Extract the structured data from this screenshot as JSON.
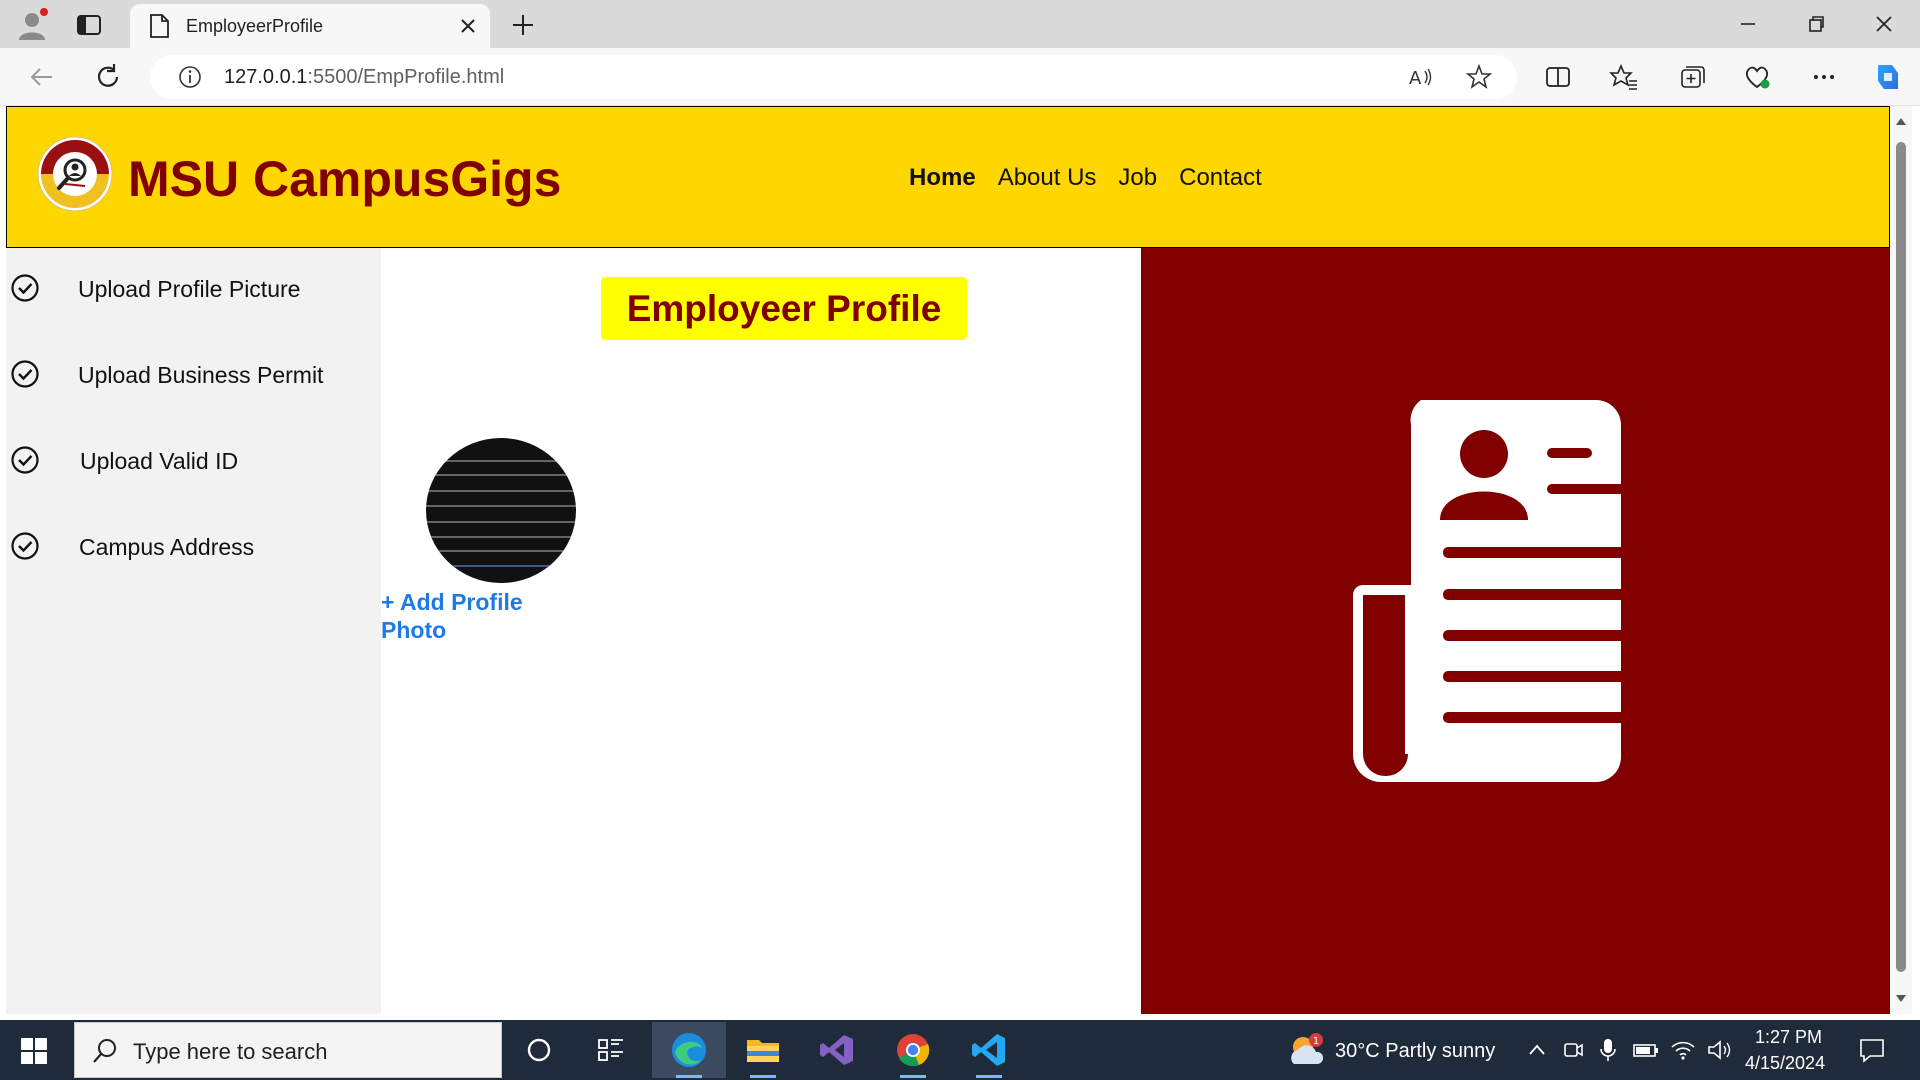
{
  "browser": {
    "tab_title": "EmployeerProfile",
    "url_host": "127.0.0.1",
    "url_path": ":5500/EmpProfile.html"
  },
  "site": {
    "brand": "MSU CampusGigs",
    "nav": [
      "Home",
      "About Us",
      "Job",
      "Contact"
    ],
    "active_nav": "Home"
  },
  "sidebar": {
    "items": [
      {
        "label": "Upload Profile Picture"
      },
      {
        "label": "Upload Business Permit"
      },
      {
        "label": "Upload Valid ID"
      },
      {
        "label": "Campus Address"
      }
    ]
  },
  "main": {
    "title": "Employeer Profile",
    "add_photo_label": "+ Add Profile Photo"
  },
  "colors": {
    "header_bg": "#ffd700",
    "brand_text": "#800000",
    "aside_bg": "#800000",
    "title_bg": "#ffff00",
    "link": "#1e7ae6"
  },
  "taskbar": {
    "search_placeholder": "Type here to search",
    "weather": "30°C  Partly sunny",
    "weather_badge": "1",
    "time": "1:27 PM",
    "date": "4/15/2024"
  }
}
